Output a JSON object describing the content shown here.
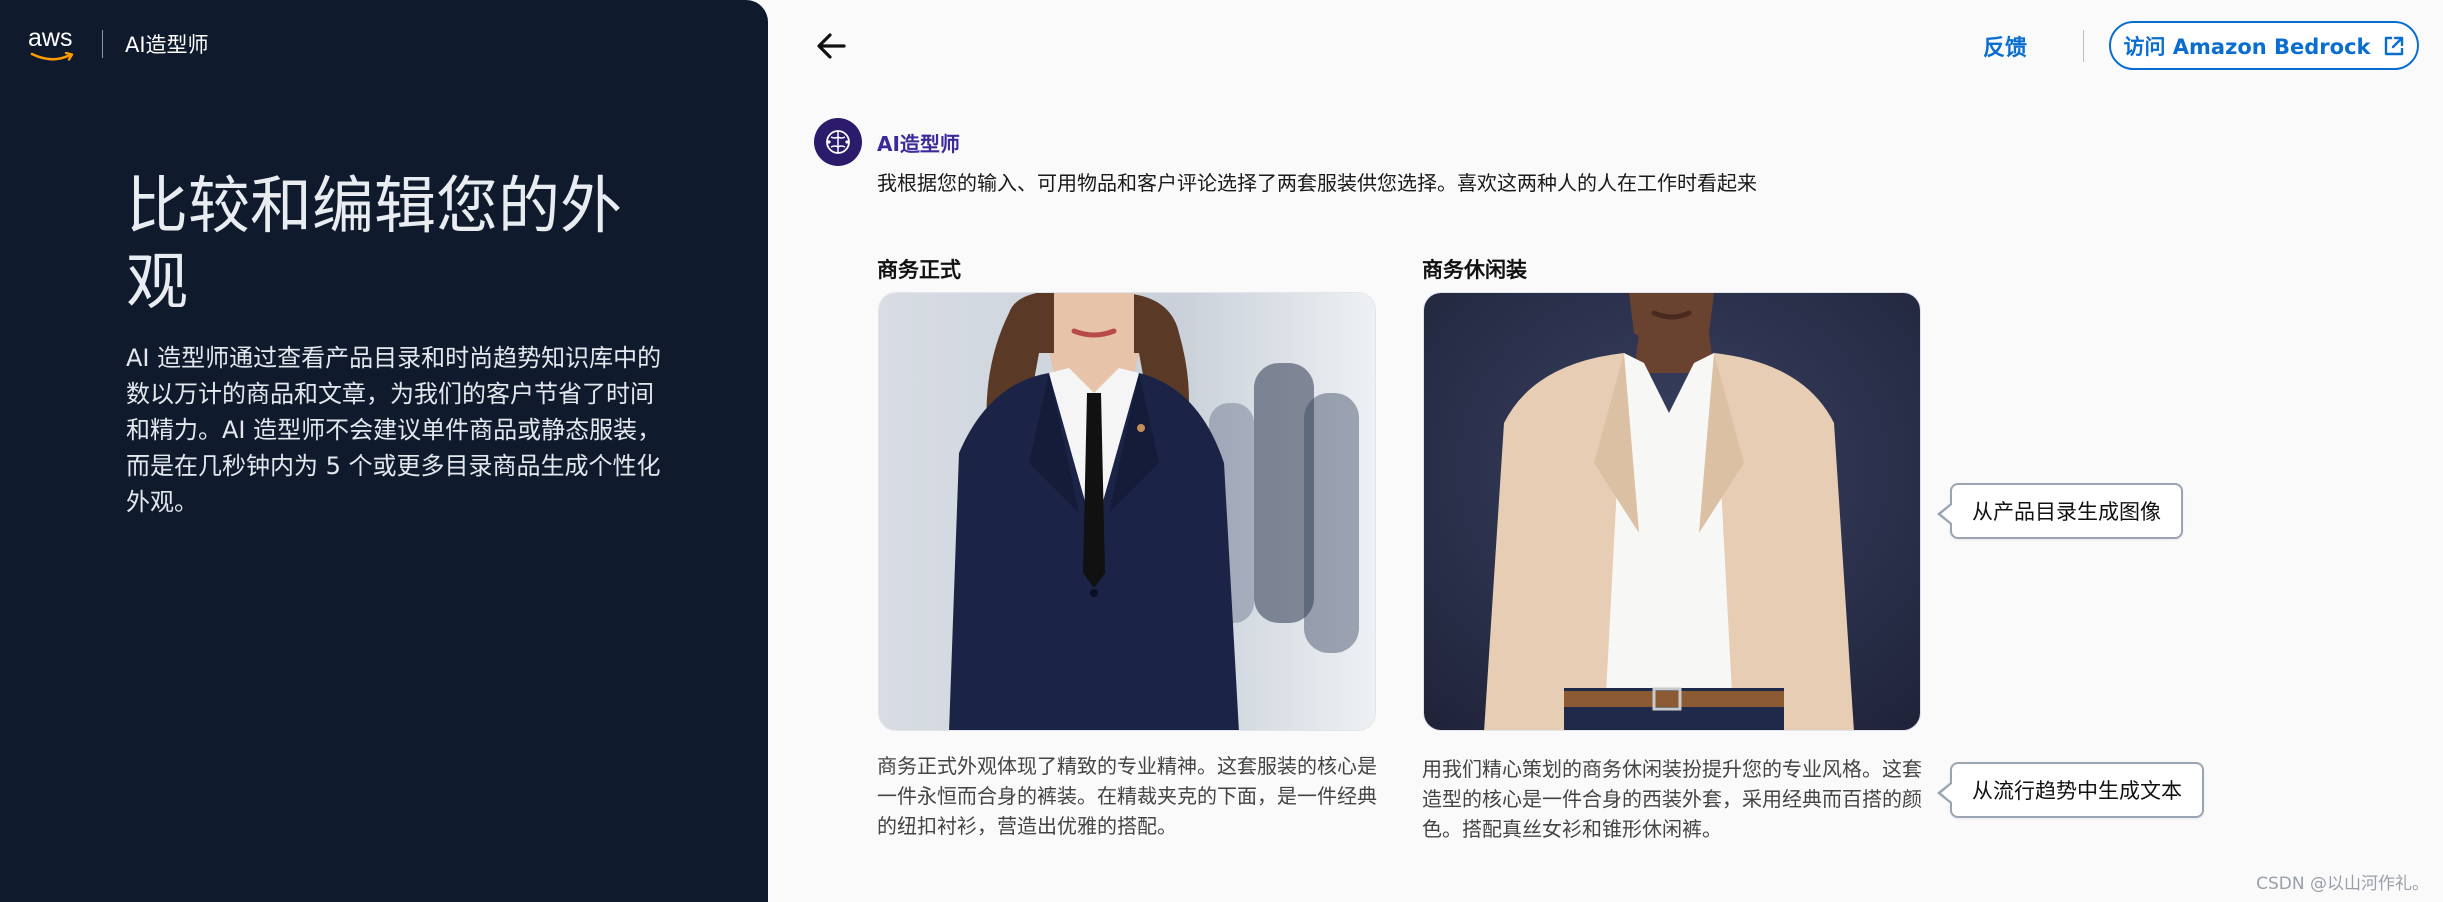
{
  "brand": {
    "logo_text": "aws",
    "app_name": "AI造型师"
  },
  "hero": {
    "title": "比较和编辑您的外观",
    "description": "AI 造型师通过查看产品目录和时尚趋势知识库中的数以万计的商品和文章，为我们的客户节省了时间和精力。AI 造型师不会建议单件商品或静态服装，而是在几秒钟内为 5 个或更多目录商品生成个性化外观。"
  },
  "header": {
    "back_icon": "arrow-left-icon",
    "feedback_label": "反馈",
    "bedrock_label": "访问 Amazon Bedrock",
    "bedrock_icon": "external-link-icon"
  },
  "chat": {
    "assistant_name": "AI造型师",
    "message": "我根据您的输入、可用物品和客户评论选择了两套服装供您选择。喜欢这两种人的人在工作时看起来"
  },
  "outfits": [
    {
      "title": "商务正式",
      "description": "商务正式外观体现了精致的专业精神。这套服装的核心是一件永恒而合身的裤装。在精裁夹克的下面，是一件经典的纽扣衬衫，营造出优雅的搭配。"
    },
    {
      "title": "商务休闲装",
      "description": "用我们精心策划的商务休闲装扮提升您的专业风格。这套造型的核心是一件合身的西装外套，采用经典而百搭的颜色。搭配真丝女衫和锥形休闲裤。"
    }
  ],
  "callouts": {
    "image": "从产品目录生成图像",
    "text": "从流行趋势中生成文本"
  },
  "watermark": "CSDN @以山河作礼。",
  "colors": {
    "sidebar": "#0f1b2d",
    "accent": "#0a6ed1",
    "assistant": "#3a2a9a"
  }
}
